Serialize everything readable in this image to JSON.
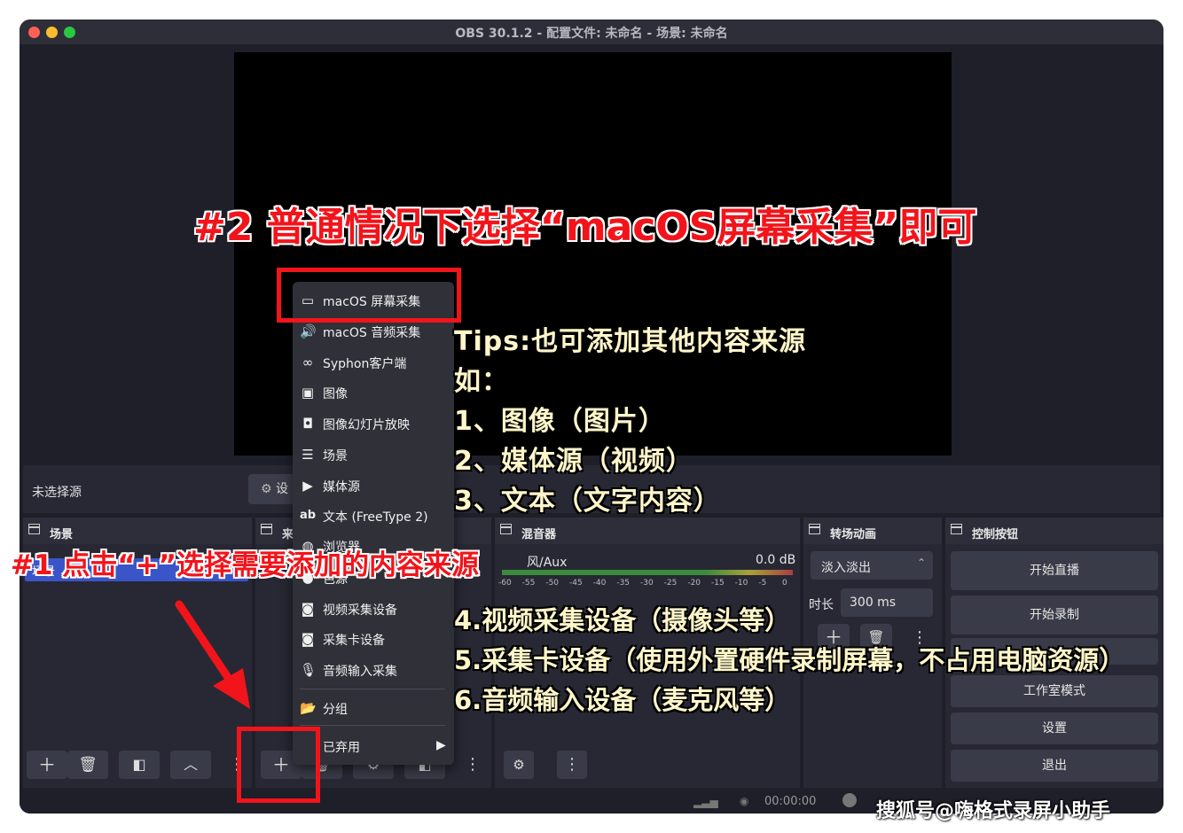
{
  "window": {
    "title": "OBS 30.1.2 - 配置文件: 未命名 - 场景: 未命名"
  },
  "source_bar": {
    "no_source": "未选择源",
    "properties_label": "设"
  },
  "docks": {
    "scenes": {
      "title": "场景",
      "selected_scene": "场景"
    },
    "sources": {
      "title": "来"
    },
    "mixer": {
      "title": "混音器",
      "channel": "风/Aux",
      "level": "0.0 dB",
      "ticks": [
        "-60",
        "-55",
        "-50",
        "-45",
        "-40",
        "-35",
        "-30",
        "-25",
        "-20",
        "-15",
        "-10",
        "-5",
        "0"
      ]
    },
    "transitions": {
      "title": "转场动画",
      "transition": "淡入淡出",
      "duration_label": "时长",
      "duration": "300 ms"
    },
    "controls": {
      "title": "控制按钮",
      "buttons": [
        "开始直播",
        "开始录制",
        "",
        "工作室模式",
        "设置",
        "退出"
      ]
    }
  },
  "menu": {
    "items": [
      {
        "icon": "monitor-icon",
        "label": "macOS 屏幕采集"
      },
      {
        "icon": "speaker-icon",
        "label": "macOS 音频采集"
      },
      {
        "icon": "syphon-icon",
        "label": "Syphon客户端"
      },
      {
        "icon": "image-icon",
        "label": "图像"
      },
      {
        "icon": "slideshow-icon",
        "label": "图像幻灯片放映"
      },
      {
        "icon": "list-icon",
        "label": "场景"
      },
      {
        "icon": "play-icon",
        "label": "媒体源"
      },
      {
        "icon": "text-icon",
        "label": "文本 (FreeType 2)"
      },
      {
        "icon": "browser-icon",
        "label": "浏览器"
      },
      {
        "icon": "color-icon",
        "label": "色源"
      },
      {
        "icon": "camera-icon",
        "label": "视频采集设备"
      },
      {
        "icon": "camera-icon",
        "label": "采集卡设备"
      },
      {
        "icon": "mic-icon",
        "label": "音频输入采集"
      },
      {
        "icon": "folder-icon",
        "label": "分组"
      },
      {
        "icon": "deprecated-icon",
        "label": "已弃用"
      }
    ]
  },
  "annotations": {
    "step2": "#2 普通情况下选择“macOS屏幕采集”即可",
    "step1": "#1 点击“+”选择需要添加的内容来源",
    "tips": [
      "Tips:也可添加其他内容来源",
      "如：",
      "1、图像（图片）",
      "2、媒体源（视频）",
      "3、文本（文字内容）"
    ],
    "tips2": [
      "4.视频采集设备（摄像头等）",
      "5.采集卡设备（使用外置硬件录制屏幕，不占用电脑资源）",
      "6.音频输入设备（麦克风等）"
    ]
  },
  "status": {
    "time": "00:00:00"
  },
  "watermark": "搜狐号@嗨格式录屏小助手",
  "colors": {
    "annotation_red": "#f2141b",
    "tips_yellow": "#fff6c9",
    "scene_selected": "#3a55c8"
  }
}
